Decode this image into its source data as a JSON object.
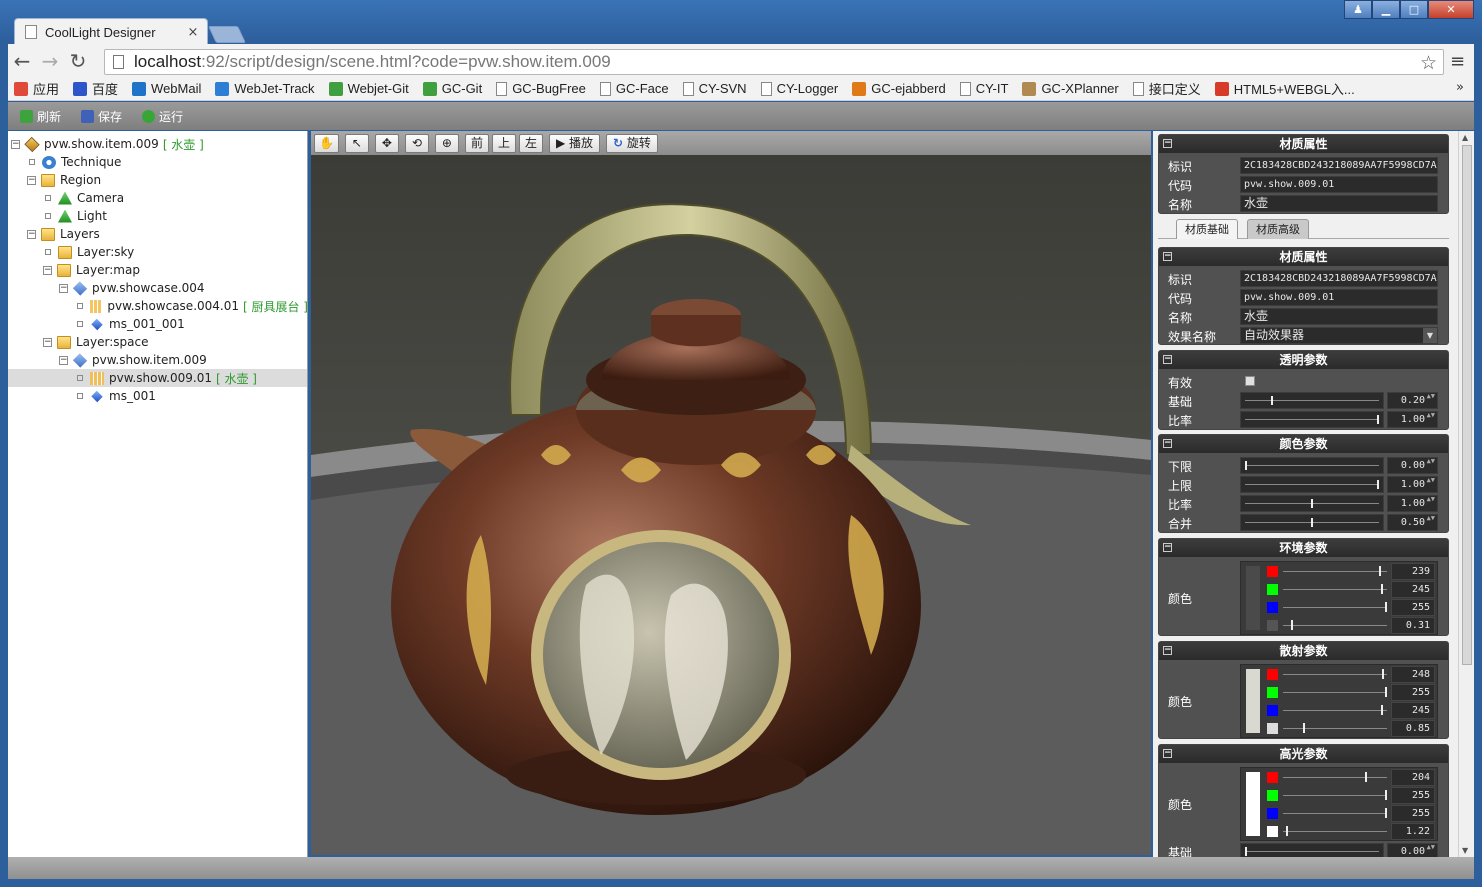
{
  "window": {
    "tab_title": "CoolLight Designer",
    "tab_close": "×",
    "min": "▁",
    "max": "□",
    "close": "✕",
    "user": "♟"
  },
  "nav": {
    "back": "←",
    "forward": "→",
    "reload": "↻",
    "url_host": "localhost",
    "url_rest": ":92/script/design/scene.html?code=pvw.show.item.009",
    "star": "☆",
    "menu": "≡"
  },
  "bookmarks": {
    "items": [
      {
        "label": "应用",
        "icon": "apps-grid-icon",
        "color": "#e04a3a"
      },
      {
        "label": "百度",
        "icon": "baidu-paw-icon",
        "color": "#2d56c8"
      },
      {
        "label": "WebMail",
        "icon": "outlook-icon",
        "color": "#1f73c8"
      },
      {
        "label": "WebJet-Track",
        "icon": "zt-icon",
        "color": "#2d7fd6"
      },
      {
        "label": "Webjet-Git",
        "icon": "git-icon",
        "color": "#40a040"
      },
      {
        "label": "GC-Git",
        "icon": "git-icon",
        "color": "#40a040"
      },
      {
        "label": "GC-BugFree",
        "icon": "doc-icon",
        "color": ""
      },
      {
        "label": "GC-Face",
        "icon": "doc-icon",
        "color": ""
      },
      {
        "label": "CY-SVN",
        "icon": "doc-icon",
        "color": ""
      },
      {
        "label": "CY-Logger",
        "icon": "doc-icon",
        "color": ""
      },
      {
        "label": "GC-ejabberd",
        "icon": "e-icon",
        "color": "#e07a18"
      },
      {
        "label": "CY-IT",
        "icon": "doc-icon",
        "color": ""
      },
      {
        "label": "GC-XPlanner",
        "icon": "planner-icon",
        "color": "#b08a50"
      },
      {
        "label": "接口定义",
        "icon": "doc-icon",
        "color": ""
      },
      {
        "label": "HTML5+WEBGL入...",
        "icon": "html5-icon",
        "color": "#d83a2a"
      }
    ],
    "more": "»"
  },
  "app_toolbar": {
    "refresh": "刷新",
    "save": "保存",
    "run": "运行"
  },
  "tree": {
    "nodes": [
      {
        "label": "pvw.show.item.009",
        "tag": "[ 水壶 ]",
        "toggle": "−",
        "icon": "ico-scene",
        "depth": 0
      },
      {
        "label": "Technique",
        "tag": "",
        "toggle": "",
        "icon": "ico-gear",
        "depth": 1
      },
      {
        "label": "Region",
        "tag": "",
        "toggle": "−",
        "icon": "ico-folder",
        "depth": 1
      },
      {
        "label": "Camera",
        "tag": "",
        "toggle": "",
        "icon": "ico-green",
        "depth": 2
      },
      {
        "label": "Light",
        "tag": "",
        "toggle": "",
        "icon": "ico-green",
        "depth": 2
      },
      {
        "label": "Layers",
        "tag": "",
        "toggle": "−",
        "icon": "ico-folder",
        "depth": 1
      },
      {
        "label": "Layer:sky",
        "tag": "",
        "toggle": "",
        "icon": "ico-folder",
        "depth": 2
      },
      {
        "label": "Layer:map",
        "tag": "",
        "toggle": "−",
        "icon": "ico-folder",
        "depth": 2
      },
      {
        "label": "pvw.showcase.004",
        "tag": "",
        "toggle": "−",
        "icon": "ico-cube",
        "depth": 3
      },
      {
        "label": "pvw.showcase.004.01",
        "tag": "[ 厨具展台 ]",
        "toggle": "",
        "icon": "ico-grid",
        "depth": 4
      },
      {
        "label": "ms_001_001",
        "tag": "",
        "toggle": "",
        "icon": "ico-gem",
        "depth": 4
      },
      {
        "label": "Layer:space",
        "tag": "",
        "toggle": "−",
        "icon": "ico-folder",
        "depth": 2
      },
      {
        "label": "pvw.show.item.009",
        "tag": "",
        "toggle": "−",
        "icon": "ico-cube",
        "depth": 3
      },
      {
        "label": "pvw.show.009.01",
        "tag": "[ 水壶 ]",
        "toggle": "",
        "icon": "ico-grid",
        "depth": 4,
        "selected": true
      },
      {
        "label": "ms_001",
        "tag": "",
        "toggle": "",
        "icon": "ico-gem",
        "depth": 4
      }
    ]
  },
  "view_toolbar": {
    "pan": "✋",
    "select": "↖",
    "move": "✥",
    "rotate": "⟲",
    "scale": "⊕",
    "front": "前",
    "top": "上",
    "left": "左",
    "play": "▶ 播放",
    "spin": "旋转"
  },
  "panel": {
    "mat_header": "材质属性",
    "id_label": "标识",
    "id_value": "2C183428CBD243218089AA7F5998CD7A",
    "code_label": "代码",
    "code_value": "pvw.show.009.01",
    "name_label": "名称",
    "name_value": "水壶",
    "tab_basic": "材质基础",
    "tab_advanced": "材质高级",
    "effect_label": "效果名称",
    "effect_value": "自动效果器",
    "dd": "▼",
    "minus": "−",
    "spin_arrows": "▲▼",
    "transparency": {
      "header": "透明参数",
      "valid_label": "有效",
      "base_label": "基础",
      "base_value": "0.20",
      "base_level": 0.2,
      "ratio_label": "比率",
      "ratio_value": "1.00",
      "ratio_level": 1.0
    },
    "color_params": {
      "header": "颜色参数",
      "rows": [
        {
          "label": "下限",
          "value": "0.00",
          "level": 0.0
        },
        {
          "label": "上限",
          "value": "1.00",
          "level": 1.0
        },
        {
          "label": "比率",
          "value": "1.00",
          "level": 0.5
        },
        {
          "label": "合并",
          "value": "0.50",
          "level": 0.5
        }
      ]
    },
    "ambient": {
      "header": "环境参数",
      "color_label": "颜色",
      "swatch": "#4a4a4a",
      "channels": [
        {
          "chip": "#ff0000",
          "value": "239",
          "level": 0.937
        },
        {
          "chip": "#00ff00",
          "value": "245",
          "level": 0.961
        },
        {
          "chip": "#0000ff",
          "value": "255",
          "level": 1.0
        },
        {
          "chip": "#555555",
          "value": "0.31",
          "level": 0.08
        }
      ]
    },
    "diffuse": {
      "header": "散射参数",
      "color_label": "颜色",
      "swatch": "#d9d9d2",
      "channels": [
        {
          "chip": "#ff0000",
          "value": "248",
          "level": 0.972
        },
        {
          "chip": "#00ff00",
          "value": "255",
          "level": 1.0
        },
        {
          "chip": "#0000ff",
          "value": "245",
          "level": 0.961
        },
        {
          "chip": "#dddddd",
          "value": "0.85",
          "level": 0.2
        }
      ]
    },
    "specular": {
      "header": "高光参数",
      "color_label": "颜色",
      "swatch": "#ffffff",
      "channels": [
        {
          "chip": "#ff0000",
          "value": "204",
          "level": 0.8
        },
        {
          "chip": "#00ff00",
          "value": "255",
          "level": 1.0
        },
        {
          "chip": "#0000ff",
          "value": "255",
          "level": 1.0
        },
        {
          "chip": "#ffffff",
          "value": "1.22",
          "level": 0.03
        }
      ],
      "base_label": "基础",
      "base_value": "0.00",
      "base_level": 0.0
    }
  }
}
